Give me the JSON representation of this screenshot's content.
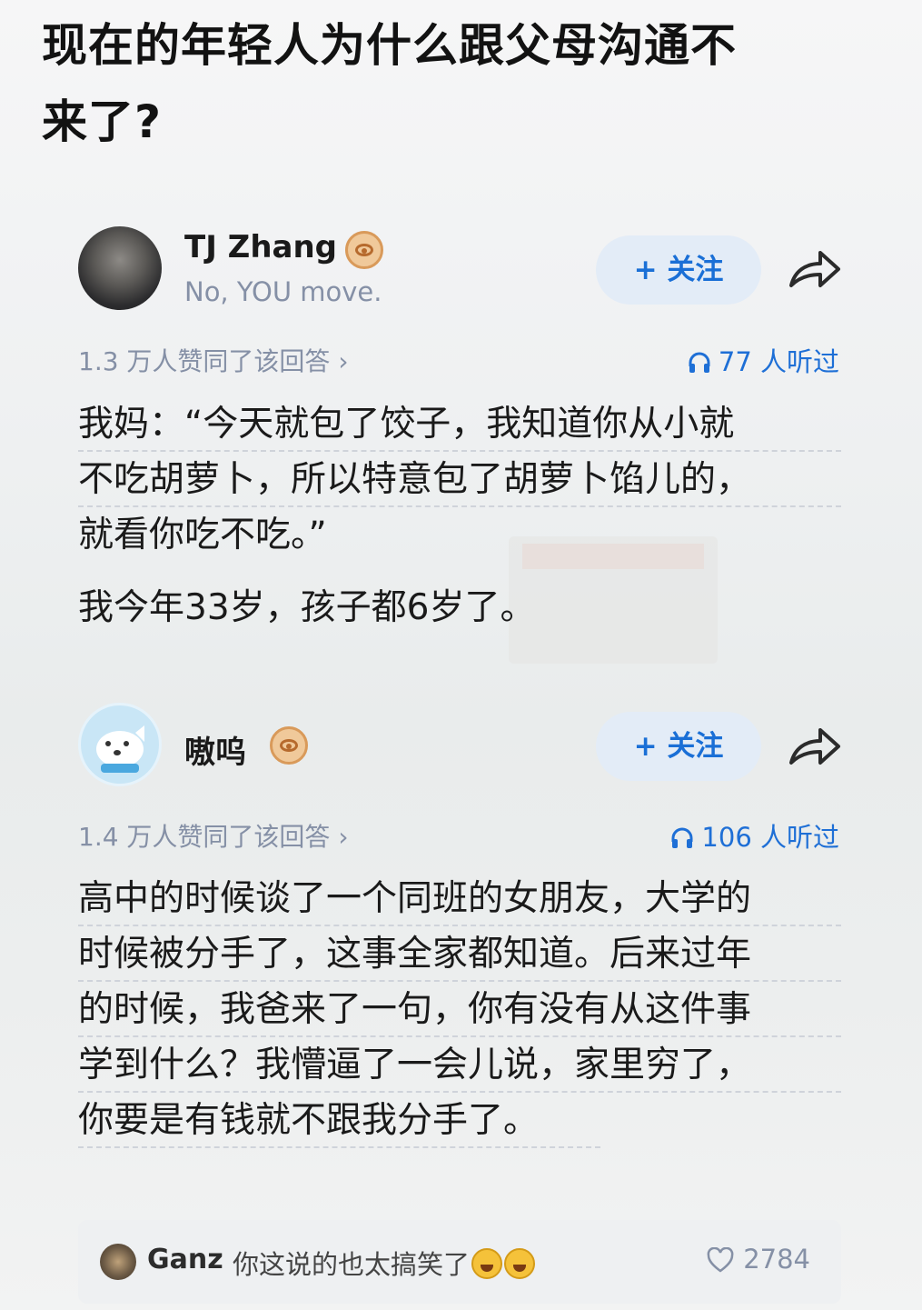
{
  "question": {
    "title_line1": "现在的年轻人为什么跟父母沟通不",
    "title_line2": "来了?"
  },
  "answers": [
    {
      "author": "TJ Zhang",
      "motto": "No, YOU move.",
      "follow_label": "+ 关注",
      "approve_text": "1.3 万人赞同了该回答 ›",
      "listen_text": "77 人听过",
      "lines": [
        "我妈：“今天就包了饺子，我知道你从小就",
        "不吃胡萝卜，所以特意包了胡萝卜馅儿的，",
        "就看你吃不吃。”"
      ],
      "extra": "我今年33岁，孩子都6岁了。"
    },
    {
      "author": "嗷呜",
      "follow_label": "+ 关注",
      "approve_text": "1.4 万人赞同了该回答 ›",
      "listen_text": "106 人听过",
      "lines": [
        "高中的时候谈了一个同班的女朋友，大学的",
        "时候被分手了，这事全家都知道。后来过年",
        "的时候，我爸来了一句，你有没有从这件事",
        "学到什么？我懵逼了一会儿说，家里穷了，",
        "你要是有钱就不跟我分手了。"
      ]
    }
  ],
  "comment": {
    "user": "Ganz",
    "text": "你这说的也太搞笑了",
    "likes": "2784"
  },
  "colors": {
    "accent": "#1e6fd6",
    "follow_bg": "#e3ecf7",
    "muted": "#8590a6"
  },
  "icons": [
    "share-arrow-icon",
    "headphone-icon",
    "heart-icon",
    "emoji-laugh-icon",
    "eye-badge-icon"
  ]
}
